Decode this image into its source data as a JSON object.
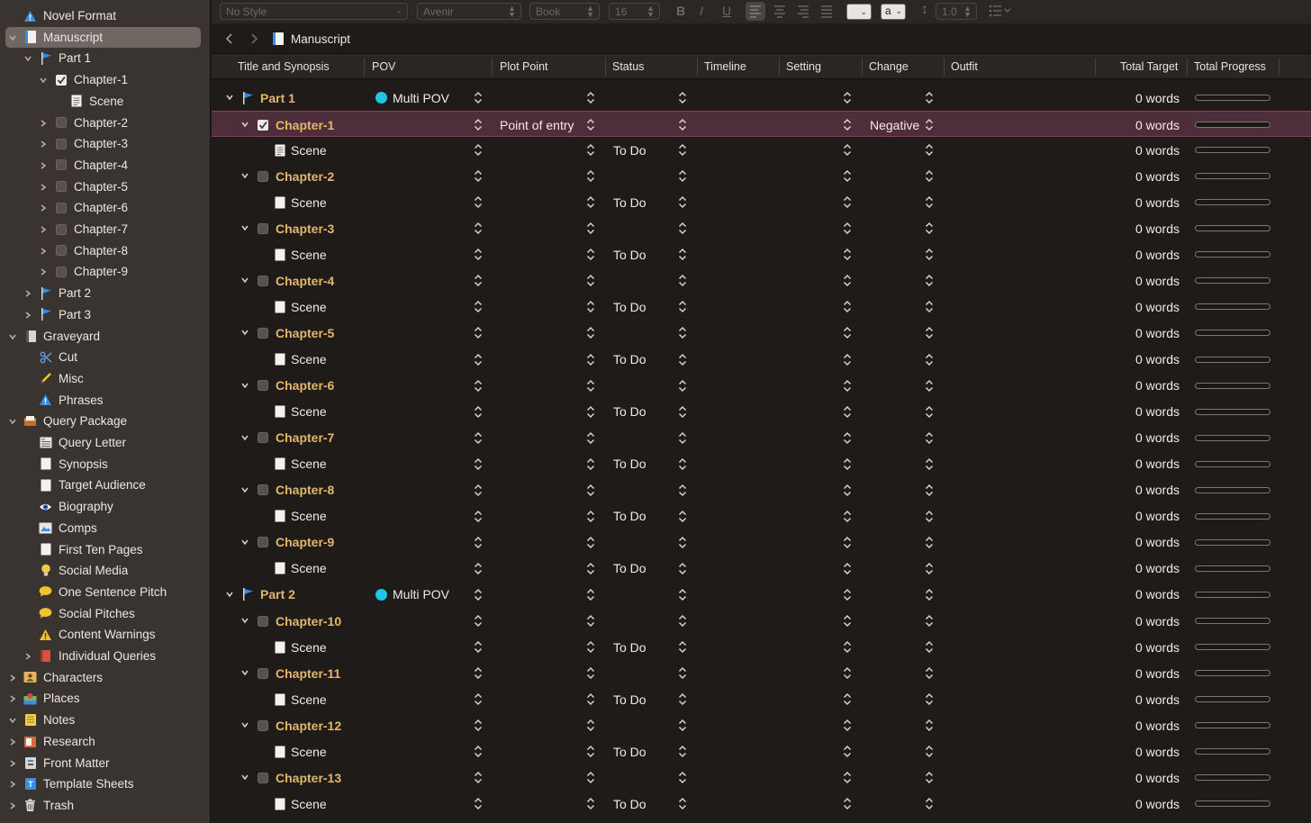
{
  "toolbar": {
    "style_value": "No Style",
    "font_value": "Avenir",
    "weight_value": "Book",
    "size_value": "16",
    "bold_label": "B",
    "italic_label": "I",
    "underline_label": "U",
    "highlight_label": "a",
    "line_spacing_value": "1.0"
  },
  "pathbar": {
    "title": "Manuscript"
  },
  "columns": {
    "title": "Title and Synopsis",
    "pov": "POV",
    "plot_point": "Plot Point",
    "status": "Status",
    "timeline": "Timeline",
    "setting": "Setting",
    "change": "Change",
    "outfit": "Outfit",
    "total_target": "Total Target",
    "total_progress": "Total Progress"
  },
  "sidebar": [
    {
      "label": "Novel Format",
      "level": 0,
      "chevron": "none",
      "icon": "warning-triangle-icon"
    },
    {
      "label": "Manuscript",
      "level": 0,
      "chevron": "down",
      "icon": "manuscript-icon",
      "selected": true
    },
    {
      "label": "Part 1",
      "level": 1,
      "chevron": "down",
      "icon": "flag-icon"
    },
    {
      "label": "Chapter-1",
      "level": 2,
      "chevron": "down",
      "icon": "checked-box-icon"
    },
    {
      "label": "Scene",
      "level": 3,
      "chevron": "none",
      "icon": "lined-document-icon"
    },
    {
      "label": "Chapter-2",
      "level": 2,
      "chevron": "right",
      "icon": "unchecked-box-icon"
    },
    {
      "label": "Chapter-3",
      "level": 2,
      "chevron": "right",
      "icon": "unchecked-box-icon"
    },
    {
      "label": "Chapter-4",
      "level": 2,
      "chevron": "right",
      "icon": "unchecked-box-icon"
    },
    {
      "label": "Chapter-5",
      "level": 2,
      "chevron": "right",
      "icon": "unchecked-box-icon"
    },
    {
      "label": "Chapter-6",
      "level": 2,
      "chevron": "right",
      "icon": "unchecked-box-icon"
    },
    {
      "label": "Chapter-7",
      "level": 2,
      "chevron": "right",
      "icon": "unchecked-box-icon"
    },
    {
      "label": "Chapter-8",
      "level": 2,
      "chevron": "right",
      "icon": "unchecked-box-icon"
    },
    {
      "label": "Chapter-9",
      "level": 2,
      "chevron": "right",
      "icon": "unchecked-box-icon"
    },
    {
      "label": "Part 2",
      "level": 1,
      "chevron": "right",
      "icon": "flag-icon"
    },
    {
      "label": "Part 3",
      "level": 1,
      "chevron": "right",
      "icon": "flag-icon"
    },
    {
      "label": "Graveyard",
      "level": 0,
      "chevron": "down",
      "icon": "notebook-icon"
    },
    {
      "label": "Cut",
      "level": 1,
      "chevron": "none",
      "icon": "scissors-icon"
    },
    {
      "label": "Misc",
      "level": 1,
      "chevron": "none",
      "icon": "pencil-icon"
    },
    {
      "label": "Phrases",
      "level": 1,
      "chevron": "none",
      "icon": "warning-triangle-icon"
    },
    {
      "label": "Query Package",
      "level": 0,
      "chevron": "down",
      "icon": "inbox-tray-icon"
    },
    {
      "label": "Query Letter",
      "level": 1,
      "chevron": "none",
      "icon": "letter-icon"
    },
    {
      "label": "Synopsis",
      "level": 1,
      "chevron": "none",
      "icon": "blank-document-icon"
    },
    {
      "label": "Target Audience",
      "level": 1,
      "chevron": "none",
      "icon": "blank-document-icon"
    },
    {
      "label": "Biography",
      "level": 1,
      "chevron": "none",
      "icon": "eye-icon"
    },
    {
      "label": "Comps",
      "level": 1,
      "chevron": "none",
      "icon": "picture-icon"
    },
    {
      "label": "First Ten Pages",
      "level": 1,
      "chevron": "none",
      "icon": "blank-document-icon"
    },
    {
      "label": "Social Media",
      "level": 1,
      "chevron": "none",
      "icon": "lightbulb-icon"
    },
    {
      "label": "One Sentence Pitch",
      "level": 1,
      "chevron": "none",
      "icon": "speech-bubble-icon"
    },
    {
      "label": "Social Pitches",
      "level": 1,
      "chevron": "none",
      "icon": "speech-bubble-icon"
    },
    {
      "label": "Content Warnings",
      "level": 1,
      "chevron": "none",
      "icon": "warning-sign-icon"
    },
    {
      "label": "Individual Queries",
      "level": 1,
      "chevron": "right",
      "icon": "red-book-icon"
    },
    {
      "label": "Characters",
      "level": 0,
      "chevron": "right",
      "icon": "contact-card-icon"
    },
    {
      "label": "Places",
      "level": 0,
      "chevron": "right",
      "icon": "map-pin-icon"
    },
    {
      "label": "Notes",
      "level": 0,
      "chevron": "down",
      "icon": "notepad-icon"
    },
    {
      "label": "Research",
      "level": 0,
      "chevron": "right",
      "icon": "research-folder-icon"
    },
    {
      "label": "Front Matter",
      "level": 0,
      "chevron": "right",
      "icon": "front-matter-icon"
    },
    {
      "label": "Template Sheets",
      "level": 0,
      "chevron": "right",
      "icon": "template-icon"
    },
    {
      "label": "Trash",
      "level": 0,
      "chevron": "right",
      "icon": "trash-icon"
    }
  ],
  "outline": [
    {
      "type": "part",
      "title": "Part 1",
      "pov": "Multi POV",
      "plot_point": "",
      "status": "",
      "change": "",
      "words": "0 words"
    },
    {
      "type": "chapter",
      "title": "Chapter-1",
      "checked": true,
      "pov": "",
      "plot_point": "Point of entry",
      "status": "",
      "change": "Negative",
      "words": "0 words",
      "selected": true
    },
    {
      "type": "scene",
      "title": "Scene",
      "icon": "lined",
      "status": "To Do",
      "words": "0 words"
    },
    {
      "type": "chapter",
      "title": "Chapter-2",
      "words": "0 words"
    },
    {
      "type": "scene",
      "title": "Scene",
      "status": "To Do",
      "words": "0 words"
    },
    {
      "type": "chapter",
      "title": "Chapter-3",
      "words": "0 words"
    },
    {
      "type": "scene",
      "title": "Scene",
      "status": "To Do",
      "words": "0 words"
    },
    {
      "type": "chapter",
      "title": "Chapter-4",
      "words": "0 words"
    },
    {
      "type": "scene",
      "title": "Scene",
      "status": "To Do",
      "words": "0 words"
    },
    {
      "type": "chapter",
      "title": "Chapter-5",
      "words": "0 words"
    },
    {
      "type": "scene",
      "title": "Scene",
      "status": "To Do",
      "words": "0 words"
    },
    {
      "type": "chapter",
      "title": "Chapter-6",
      "words": "0 words"
    },
    {
      "type": "scene",
      "title": "Scene",
      "status": "To Do",
      "words": "0 words"
    },
    {
      "type": "chapter",
      "title": "Chapter-7",
      "words": "0 words"
    },
    {
      "type": "scene",
      "title": "Scene",
      "status": "To Do",
      "words": "0 words"
    },
    {
      "type": "chapter",
      "title": "Chapter-8",
      "words": "0 words"
    },
    {
      "type": "scene",
      "title": "Scene",
      "status": "To Do",
      "words": "0 words"
    },
    {
      "type": "chapter",
      "title": "Chapter-9",
      "words": "0 words"
    },
    {
      "type": "scene",
      "title": "Scene",
      "status": "To Do",
      "words": "0 words"
    },
    {
      "type": "part",
      "title": "Part 2",
      "pov": "Multi POV",
      "words": "0 words"
    },
    {
      "type": "chapter",
      "title": "Chapter-10",
      "words": "0 words"
    },
    {
      "type": "scene",
      "title": "Scene",
      "status": "To Do",
      "words": "0 words"
    },
    {
      "type": "chapter",
      "title": "Chapter-11",
      "words": "0 words"
    },
    {
      "type": "scene",
      "title": "Scene",
      "status": "To Do",
      "words": "0 words"
    },
    {
      "type": "chapter",
      "title": "Chapter-12",
      "words": "0 words"
    },
    {
      "type": "scene",
      "title": "Scene",
      "status": "To Do",
      "words": "0 words"
    },
    {
      "type": "chapter",
      "title": "Chapter-13",
      "words": "0 words"
    },
    {
      "type": "scene",
      "title": "Scene",
      "status": "To Do",
      "words": "0 words"
    }
  ],
  "colors": {
    "accent_title": "#e3b66b",
    "selected_row": "#4f2e3c",
    "pov_dot": "#21c4e6",
    "sidebar_selected": "#6e6762"
  }
}
